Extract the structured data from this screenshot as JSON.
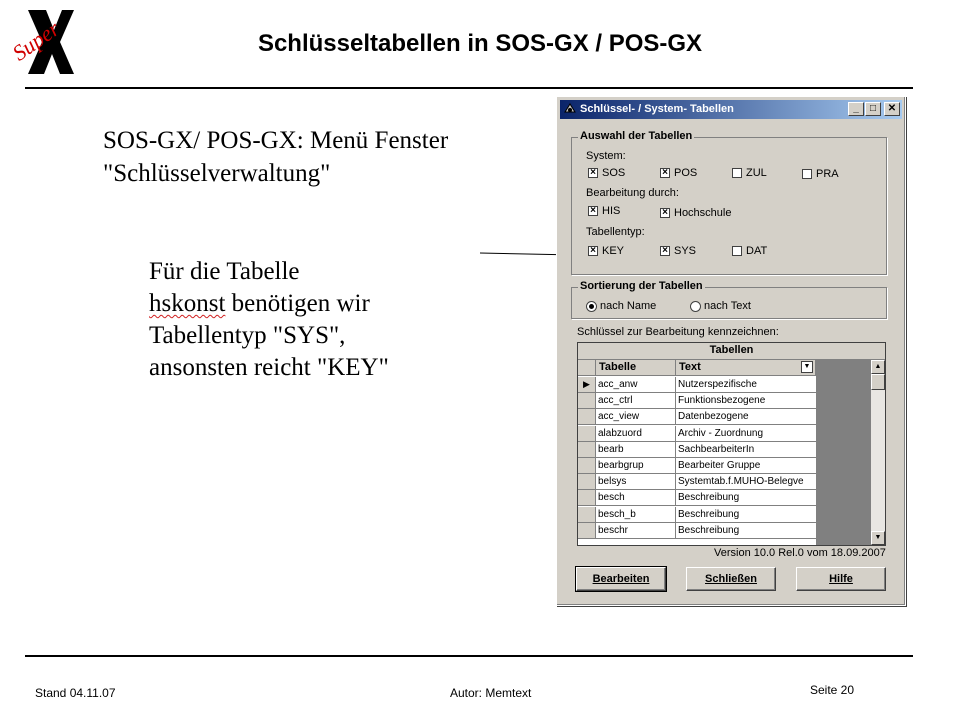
{
  "slide": {
    "title": "Schlüsseltabellen in SOS-GX / POS-GX",
    "intro_line1": "SOS-GX/ POS-GX: Menü Fenster",
    "intro_line2": "\"Schlüsselverwaltung\"",
    "note_line1": "Für die Tabelle",
    "note_line2_word": "hskonst",
    "note_line2_rest": " benötigen wir",
    "note_line3": "Tabellentyp \"SYS\",",
    "note_line4": "ansonsten reicht \"KEY\"",
    "logo_text": "Super"
  },
  "footer": {
    "left": "Stand 04.11.07",
    "center": "Autor: Memtext",
    "right": "Seite 20"
  },
  "dialog": {
    "title": "Schlüssel- / System- Tabellen",
    "minimize": "_",
    "maximize": "□",
    "close": "✕",
    "group_select": "Auswahl der Tabellen",
    "system_label": "System:",
    "system": [
      {
        "label": "SOS",
        "checked": true
      },
      {
        "label": "POS",
        "checked": true
      },
      {
        "label": "ZUL",
        "checked": false
      },
      {
        "label": "PRA",
        "checked": false
      }
    ],
    "edit_label": "Bearbeitung durch:",
    "edit": [
      {
        "label": "HIS",
        "checked": true
      },
      {
        "label": "Hochschule",
        "checked": true
      }
    ],
    "type_label": "Tabellentyp:",
    "types": [
      {
        "label": "KEY",
        "checked": true
      },
      {
        "label": "SYS",
        "checked": true
      },
      {
        "label": "DAT",
        "checked": false
      }
    ],
    "group_sort": "Sortierung der Tabellen",
    "sort_name": "nach Name",
    "sort_text": "nach Text",
    "sort_selected": "nach Name",
    "mark_label": "Schlüssel zur Bearbeitung kennzeichnen:",
    "grid_caption": "Tabellen",
    "col_table": "Tabelle",
    "col_text": "Text",
    "rows": [
      {
        "table": "acc_anw",
        "text": "Nutzerspezifische"
      },
      {
        "table": "acc_ctrl",
        "text": "Funktionsbezogene"
      },
      {
        "table": "acc_view",
        "text": "Datenbezogene"
      },
      {
        "table": "alabzuord",
        "text": "Archiv - Zuordnung"
      },
      {
        "table": "bearb",
        "text": "SachbearbeiterIn"
      },
      {
        "table": "bearbgrup",
        "text": "Bearbeiter Gruppe"
      },
      {
        "table": "belsys",
        "text": "Systemtab.f.MUHO-Belegve"
      },
      {
        "table": "besch",
        "text": "Beschreibung"
      },
      {
        "table": "besch_b",
        "text": "Beschreibung"
      },
      {
        "table": "beschr",
        "text": "Beschreibung"
      }
    ],
    "version": "Version 10.0 Rel.0 vom 18.09.2007",
    "btn_edit": "Bearbeiten",
    "btn_close": "Schließen",
    "btn_help": "Hilfe"
  }
}
